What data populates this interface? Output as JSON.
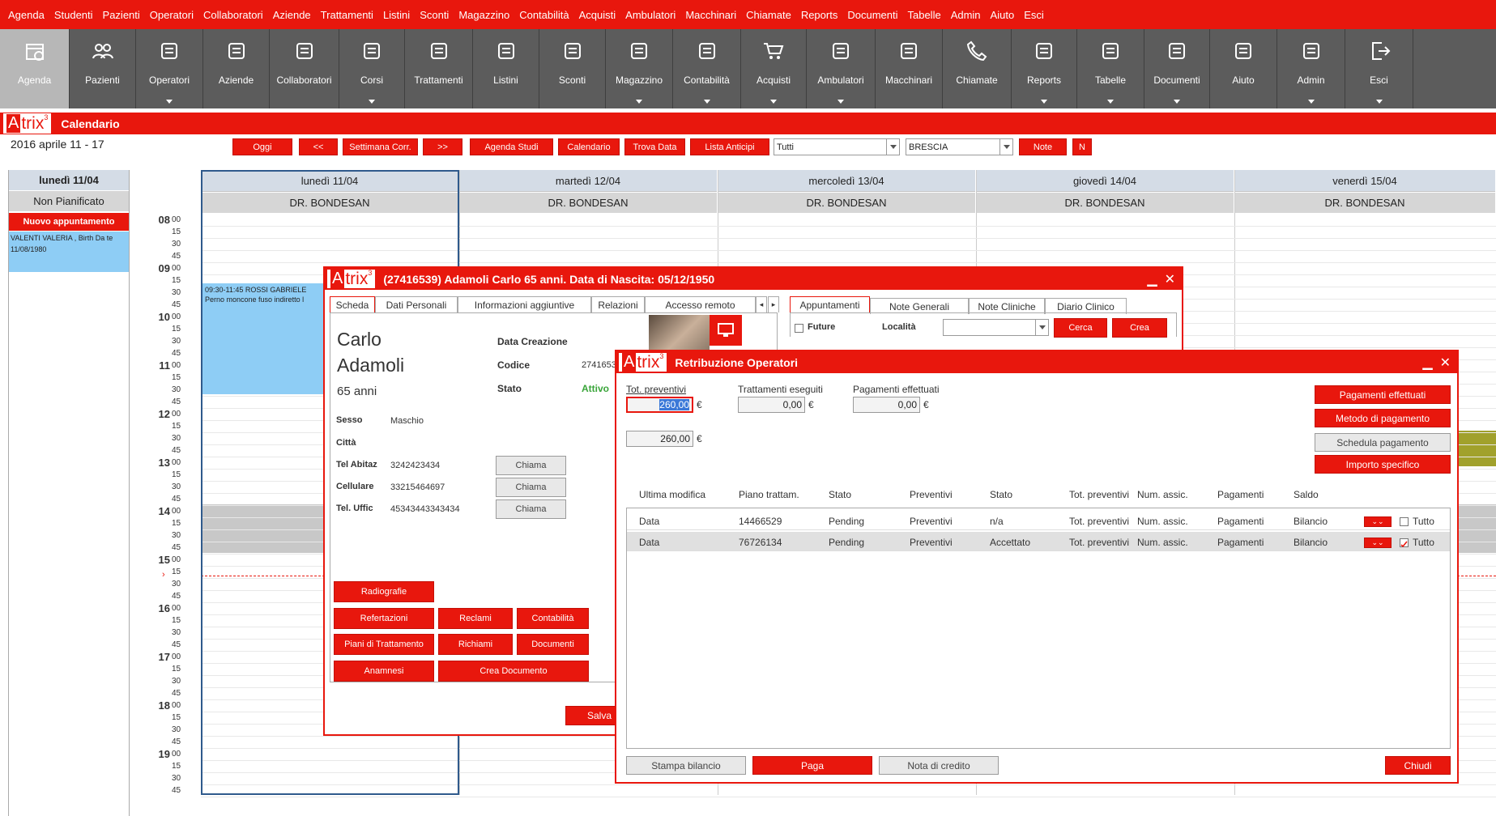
{
  "menu": [
    "Agenda",
    "Studenti",
    "Pazienti",
    "Operatori",
    "Collaboratori",
    "Aziende",
    "Trattamenti",
    "Listini",
    "Sconti",
    "Magazzino",
    "Contabilità",
    "Acquisti",
    "Ambulatori",
    "Macchinari",
    "Chiamate",
    "Reports",
    "Documenti",
    "Tabelle",
    "Admin",
    "Aiuto",
    "Esci"
  ],
  "toolbar": [
    {
      "label": "Agenda",
      "icon": "calendar-icon",
      "dd": false
    },
    {
      "label": "Pazienti",
      "icon": "people-icon",
      "dd": false
    },
    {
      "label": "Operatori",
      "icon": "operator-icon",
      "dd": true
    },
    {
      "label": "Aziende",
      "icon": "briefcase-icon",
      "dd": false
    },
    {
      "label": "Collaboratori",
      "icon": "collaborator-icon",
      "dd": false
    },
    {
      "label": "Corsi",
      "icon": "book-icon",
      "dd": true
    },
    {
      "label": "Trattamenti",
      "icon": "treatment-icon",
      "dd": false
    },
    {
      "label": "Listini",
      "icon": "pricelist-icon",
      "dd": false
    },
    {
      "label": "Sconti",
      "icon": "discount-icon",
      "dd": false
    },
    {
      "label": "Magazzino",
      "icon": "warehouse-icon",
      "dd": true
    },
    {
      "label": "Contabilità",
      "icon": "coins-icon",
      "dd": true
    },
    {
      "label": "Acquisti",
      "icon": "cart-icon",
      "dd": true
    },
    {
      "label": "Ambulatori",
      "icon": "clinic-icon",
      "dd": true
    },
    {
      "label": "Macchinari",
      "icon": "machine-icon",
      "dd": false
    },
    {
      "label": "Chiamate",
      "icon": "phone-icon",
      "dd": false
    },
    {
      "label": "Reports",
      "icon": "report-icon",
      "dd": true
    },
    {
      "label": "Tabelle",
      "icon": "table-icon",
      "dd": true
    },
    {
      "label": "Documenti",
      "icon": "document-icon",
      "dd": true
    },
    {
      "label": "Aiuto",
      "icon": "help-icon",
      "dd": false
    },
    {
      "label": "Admin",
      "icon": "admin-icon",
      "dd": true
    },
    {
      "label": "Esci",
      "icon": "exit-icon",
      "dd": true
    }
  ],
  "cal": {
    "logo": "trix",
    "logo_a": "A",
    "logo_sup": "3",
    "title": "Calendario",
    "range": "2016 aprile 11 - 17",
    "buttons": {
      "oggi": "Oggi",
      "prev": "<<",
      "sett": "Settimana Corr.",
      "next": ">>",
      "agenda": "Agenda Studi",
      "calendario": "Calendario",
      "trova": "Trova Data",
      "lista": "Lista Anticipi",
      "note": "Note",
      "n": "N"
    },
    "sel_tutti": "Tutti",
    "sel_city": "BRESCIA",
    "left_day": "lunedì 11/04",
    "non_pian": "Non Pianificato",
    "nuovo": "Nuovo appuntamento",
    "pending_appt": "VALENTI VALERIA , Birth Da te 11/08/1980",
    "days": [
      "lunedì 11/04",
      "martedì 12/04",
      "mercoledì 13/04",
      "giovedì 14/04",
      "venerdì 15/04"
    ],
    "doctor": "DR. BONDESAN",
    "hours": [
      "08",
      "09",
      "10",
      "11",
      "12",
      "13",
      "14",
      "15",
      "16",
      "17",
      "18",
      "19"
    ],
    "mins": [
      "00",
      "15",
      "30",
      "45"
    ],
    "appt_time": "09:30-11:45 ROSSI GABRIELE",
    "appt_desc": "Perno moncone fuso indiretto l"
  },
  "patient": {
    "title": "(27416539) Adamoli Carlo 65 anni. Data di Nascita: 05/12/1950",
    "tabs": [
      "Scheda",
      "Dati Personali",
      "Informazioni aggiuntive",
      "Relazioni",
      "Accesso remoto"
    ],
    "name1": "Carlo",
    "name2": "Adamoli",
    "age": "65 anni",
    "l_creazione": "Data Creazione",
    "l_codice": "Codice",
    "codice": "2741653",
    "l_stato": "Stato",
    "stato": "Attivo",
    "l_sesso": "Sesso",
    "sesso": "Maschio",
    "l_citta": "Città",
    "l_abitaz": "Tel Abitaz",
    "abitaz": "3242423434",
    "l_cell": "Cellulare",
    "cell": "33215464697",
    "l_uffic": "Tel. Uffic",
    "uffic": "45343443343434",
    "chiama": "Chiama",
    "b_radio": "Radiografie",
    "b_ref": "Refertazioni",
    "b_recl": "Reclami",
    "b_cont": "Contabilità",
    "b_piani": "Piani di Trattamento",
    "b_rich": "Richiami",
    "b_doc": "Documenti",
    "b_anam": "Anamnesi",
    "b_crea": "Crea Documento",
    "b_salva": "Salva",
    "rtabs": [
      "Appuntamenti",
      "Note Generali",
      "Note Cliniche",
      "Diario Clinico"
    ],
    "future": "Future",
    "localita": "Località",
    "cerca": "Cerca",
    "crea": "Crea"
  },
  "retr": {
    "title": "Retribuzione Operatori",
    "l_tot": "Tot. preventivi",
    "tot": "260,00",
    "l_tratt": "Trattamenti eseguiti",
    "tratt": "0,00",
    "l_pag": "Pagamenti effettuati",
    "pag": "0,00",
    "eur": "€",
    "second": "260,00",
    "b_pagamenti": "Pagamenti effettuati",
    "b_metodo": "Metodo di pagamento",
    "b_schedula": "Schedula pagamento",
    "b_importo": "Importo specifico",
    "headers": [
      "Ultima modifica",
      "Piano trattam.",
      "Stato",
      "Preventivi",
      "Stato",
      "Tot. preventivi",
      "Num. assic.",
      "Pagamenti",
      "Saldo"
    ],
    "rows": [
      {
        "c": [
          "Data",
          "14466529",
          "Pending",
          "Preventivi",
          "n/a",
          "Tot. preventivi",
          "Num. assic.",
          "Pagamenti",
          "Bilancio"
        ],
        "tutto": "Tutto",
        "checked": false
      },
      {
        "c": [
          "Data",
          "76726134",
          "Pending",
          "Preventivi",
          "Accettato",
          "Tot. preventivi",
          "Num. assic.",
          "Pagamenti",
          "Bilancio"
        ],
        "tutto": "Tutto",
        "checked": true
      }
    ],
    "b_stampa": "Stampa bilancio",
    "b_paga": "Paga",
    "b_nota": "Nota di credito",
    "b_chiudi": "Chiudi"
  }
}
